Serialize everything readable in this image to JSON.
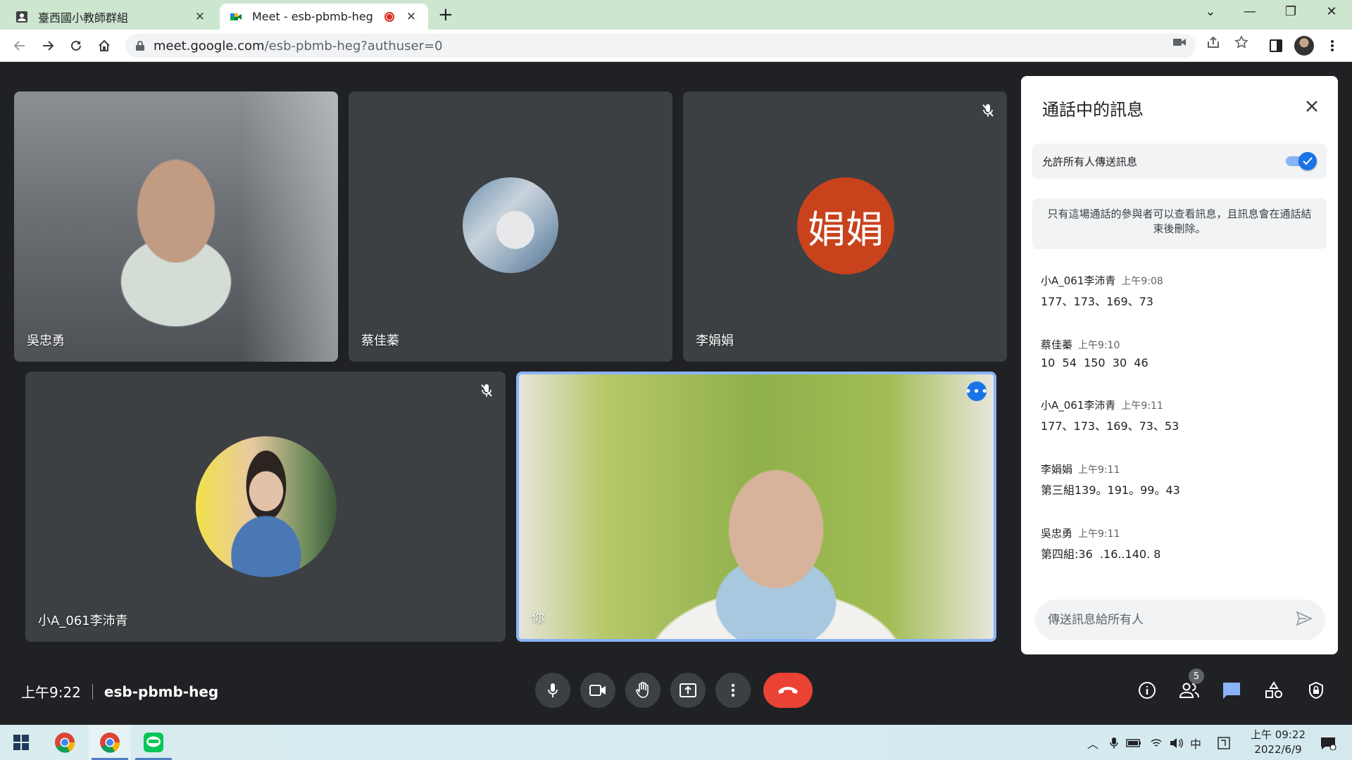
{
  "browser": {
    "tabs": [
      {
        "title": "臺西國小教師群組",
        "active": false
      },
      {
        "title": "Meet - esb-pbmb-heg",
        "active": true
      }
    ],
    "url_host": "meet.google.com",
    "url_path": "/esb-pbmb-heg?authuser=0"
  },
  "participants": [
    {
      "name": "吳忠勇",
      "video": true
    },
    {
      "name": "蔡佳蓁",
      "video": false
    },
    {
      "name": "李娟娟",
      "video": false,
      "initials": "娟娟",
      "avatar_color": "#c8421c"
    },
    {
      "name": "小A_061李沛青",
      "video": false
    },
    {
      "name": "你",
      "video": true
    }
  ],
  "chat": {
    "title": "通話中的訊息",
    "allow_label": "允許所有人傳送訊息",
    "allow_enabled": true,
    "notice": "只有這場通話的參與者可以查看訊息，且訊息會在通話結束後刪除。",
    "messages": [
      {
        "sender": "小A_061李沛青",
        "time": "上午9:08",
        "text": "177、173、169、73"
      },
      {
        "sender": "蔡佳蓁",
        "time": "上午9:10",
        "text": "10  54  150  30  46"
      },
      {
        "sender": "小A_061李沛青",
        "time": "上午9:11",
        "text": "177、173、169、73、53"
      },
      {
        "sender": "李娟娟",
        "time": "上午9:11",
        "text": "第三組139。191。99。43"
      },
      {
        "sender": "吳忠勇",
        "time": "上午9:11",
        "text": "第四組:36  .16..140. 8"
      }
    ],
    "compose_placeholder": "傳送訊息給所有人"
  },
  "meeting": {
    "time": "上午9:22",
    "code": "esb-pbmb-heg",
    "people_count": "5"
  },
  "taskbar": {
    "clock_time": "上午 09:22",
    "clock_date": "2022/6/9",
    "ime": "中"
  },
  "colors": {
    "accent": "#1a73e8",
    "end_call": "#ea4335",
    "stage_bg": "#202124",
    "tile_bg": "#3c4043"
  }
}
